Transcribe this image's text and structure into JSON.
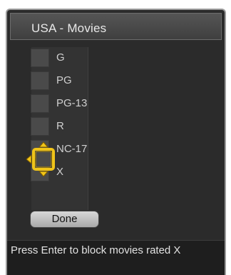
{
  "dialog": {
    "title": "USA - Movies"
  },
  "ratings": [
    {
      "label": "G",
      "checked": false
    },
    {
      "label": "PG",
      "checked": false
    },
    {
      "label": "PG-13",
      "checked": false
    },
    {
      "label": "R",
      "checked": false
    },
    {
      "label": "NC-17",
      "checked": false
    },
    {
      "label": "X",
      "checked": false,
      "focused": true
    }
  ],
  "buttons": {
    "done_label": "Done"
  },
  "footer": {
    "help_text": "Press Enter to block movies rated X"
  },
  "colors": {
    "panel_bg": "#2b2b2b",
    "focus_accent": "#f0c419"
  }
}
